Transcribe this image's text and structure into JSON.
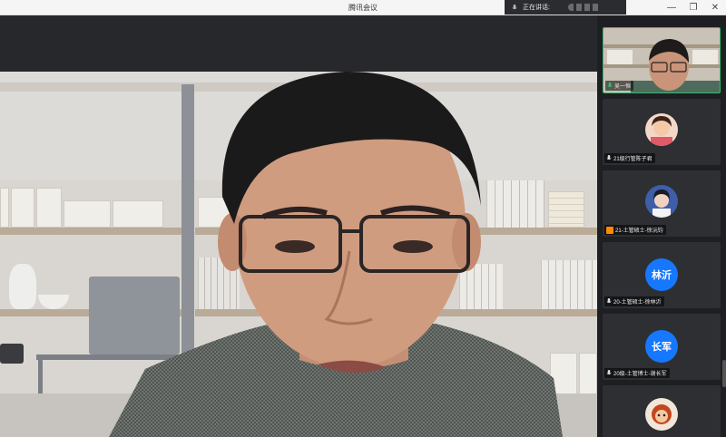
{
  "window": {
    "title": "腾讯会议",
    "controls": [
      "minimize-icon",
      "maximize-icon",
      "close-icon"
    ]
  },
  "speaking": {
    "label": "正在讲话:"
  },
  "participants": [
    {
      "name": "吴一恒",
      "active": true,
      "mic": "on"
    },
    {
      "name": "21级行管陈子君",
      "active": false,
      "mic": "on"
    },
    {
      "name": "21-土管硕士-徐沅钧",
      "active": false,
      "mic": "off"
    },
    {
      "name": "20-土管硕士-徐林沂",
      "avatar_text": "林沂",
      "active": false,
      "mic": "on"
    },
    {
      "name": "20级-土管博士-谢长军",
      "avatar_text": "长军",
      "active": false,
      "mic": "on"
    },
    {
      "name": "",
      "active": false
    }
  ],
  "colors": {
    "accent": "#1677ff",
    "active_border": "#2fbf71",
    "background": "#1e1f22"
  }
}
